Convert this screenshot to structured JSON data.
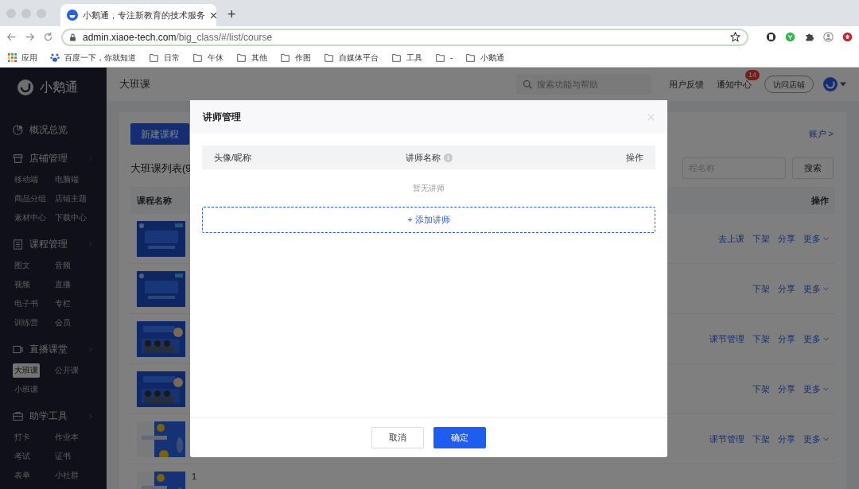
{
  "browser": {
    "tab": {
      "title": "小鹅通，专注新教育的技术服务"
    },
    "url": {
      "host": "admin.xiaoe-tech.com",
      "path": "/big_class/#/list/course"
    },
    "new_tab": "+",
    "bookmarks": [
      {
        "kind": "apps",
        "label": "应用"
      },
      {
        "kind": "baidu",
        "label": "百度一下，你就知道"
      },
      {
        "kind": "folder",
        "label": "日常"
      },
      {
        "kind": "folder",
        "label": "午休"
      },
      {
        "kind": "folder",
        "label": "其他"
      },
      {
        "kind": "folder",
        "label": "作图"
      },
      {
        "kind": "folder",
        "label": "自媒体平台"
      },
      {
        "kind": "folder",
        "label": "工具"
      },
      {
        "kind": "folder",
        "label": "-"
      },
      {
        "kind": "folder",
        "label": "小鹅通"
      }
    ]
  },
  "sidebar": {
    "brand": "小鹅通",
    "groups": [
      {
        "kind": "overview",
        "label": "概况总览"
      },
      {
        "kind": "shop",
        "label": "店铺管理",
        "items": [
          {
            "label": "移动端",
            "selected": false
          },
          {
            "label": "电脑端",
            "selected": false
          },
          {
            "label": "商品分组",
            "selected": false
          },
          {
            "label": "店铺主题",
            "selected": false
          },
          {
            "label": "素材中心",
            "selected": false
          },
          {
            "label": "下载中心",
            "selected": false
          }
        ]
      },
      {
        "kind": "course",
        "label": "课程管理",
        "items": [
          {
            "label": "图文",
            "selected": false
          },
          {
            "label": "音频",
            "selected": false
          },
          {
            "label": "视频",
            "selected": false
          },
          {
            "label": "直播",
            "selected": false
          },
          {
            "label": "电子书",
            "selected": false
          },
          {
            "label": "专栏",
            "selected": false
          },
          {
            "label": "训练营",
            "selected": false
          },
          {
            "label": "会员",
            "selected": false
          }
        ]
      },
      {
        "kind": "live",
        "label": "直播课堂",
        "items": [
          {
            "label": "大班课",
            "selected": true
          },
          {
            "label": "公开课",
            "selected": false
          },
          {
            "label": "小班课",
            "selected": false
          }
        ]
      },
      {
        "kind": "tools",
        "label": "助学工具",
        "items": [
          {
            "label": "打卡",
            "selected": false
          },
          {
            "label": "作业本",
            "selected": false
          },
          {
            "label": "考试",
            "selected": false
          },
          {
            "label": "证书",
            "selected": false
          },
          {
            "label": "表单",
            "selected": false
          },
          {
            "label": "小社群",
            "selected": false
          }
        ]
      }
    ]
  },
  "header": {
    "title": "大班课",
    "search": {
      "placeholder": "搜索功能与帮助"
    },
    "links": [
      "用户反馈",
      "通知中心"
    ],
    "badge": "14",
    "visit_button": "访问店铺"
  },
  "content": {
    "new_button": "新建课程",
    "account_link": "账户 >",
    "list_title": "大班课列表(9",
    "search": {
      "placeholder": "程名称"
    },
    "search_button": "搜索",
    "columns": [
      "课程名称",
      "操作"
    ],
    "rows": [
      {
        "actions": [
          "去上课",
          "下架",
          "分享",
          "更多"
        ]
      },
      {
        "actions": [
          "下架",
          "分享",
          "更多"
        ]
      },
      {
        "actions": [
          "课节管理",
          "下架",
          "分享",
          "更多"
        ]
      },
      {
        "actions": [
          "下架",
          "分享",
          "更多"
        ]
      },
      {
        "actions": [
          "课节管理",
          "下架",
          "分享",
          "更多"
        ]
      },
      {
        "text": "1"
      }
    ]
  },
  "modal": {
    "title": "讲师管理",
    "columns": [
      "头像/昵称",
      "讲师名称",
      "操作"
    ],
    "empty_text": "暂无讲师",
    "add_button": "+ 添加讲师",
    "buttons": [
      {
        "kind": "secondary",
        "label": "取消"
      },
      {
        "kind": "primary",
        "label": "确定"
      }
    ]
  }
}
